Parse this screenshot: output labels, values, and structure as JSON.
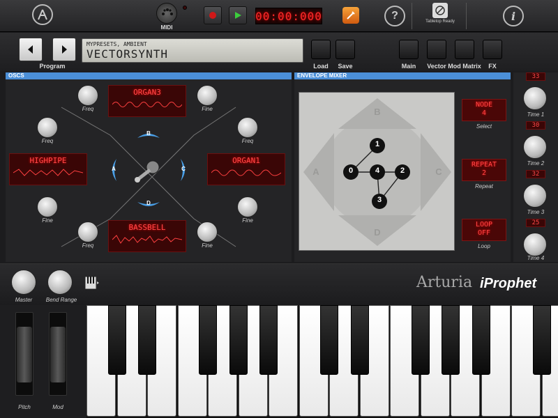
{
  "topbar": {
    "midi_label": "MIDI",
    "timer": "00:00:000",
    "tabletop_label": "Tabletop Ready",
    "help_icon": "question-icon",
    "info_icon": "info-icon"
  },
  "program": {
    "label": "Program",
    "path": "MYPRESETS, AMBIENT",
    "name": "VECTORSYNTH",
    "load_label": "Load",
    "save_label": "Save"
  },
  "tabs": [
    {
      "label": "Main"
    },
    {
      "label": "Vector"
    },
    {
      "label": "Mod Matrix"
    },
    {
      "label": "FX"
    }
  ],
  "oscs": {
    "title": "OSCS",
    "top_display": "ORGAN3",
    "left_display": "HIGHPIPE",
    "right_display": "ORGAN1",
    "bottom_display": "BASSBELL",
    "freq_label": "Freq",
    "fine_label": "Fine",
    "arrow_a": "A",
    "arrow_b": "B",
    "arrow_c": "C",
    "arrow_d": "D"
  },
  "envelope_mixer": {
    "title": "ENVELOPE MIXER",
    "pad_a": "A",
    "pad_b": "B",
    "pad_c": "C",
    "pad_d": "D",
    "nodes": [
      "0",
      "1",
      "2",
      "3",
      "4"
    ],
    "node_display_line1": "NODE",
    "node_display_line2": "4",
    "select_label": "Select",
    "repeat_display_line1": "REPEAT",
    "repeat_display_line2": "2",
    "repeat_label": "Repeat",
    "loop_display_line1": "LOOP",
    "loop_display_line2": "OFF",
    "loop_label": "Loop"
  },
  "times": [
    {
      "value": "33",
      "label": "Time 1"
    },
    {
      "value": "30",
      "label": "Time 2"
    },
    {
      "value": "32",
      "label": "Time 3"
    },
    {
      "value": "25",
      "label": "Time 4"
    }
  ],
  "bottom": {
    "master_label": "Master",
    "bend_label": "Bend Range",
    "brand": "Arturia",
    "product": "iProphet"
  },
  "wheels": {
    "pitch_label": "Pitch",
    "mod_label": "Mod"
  },
  "colors": {
    "accent_blue": "#4b8fd8",
    "led_red": "#ff4848",
    "panel_dark": "#242426"
  }
}
